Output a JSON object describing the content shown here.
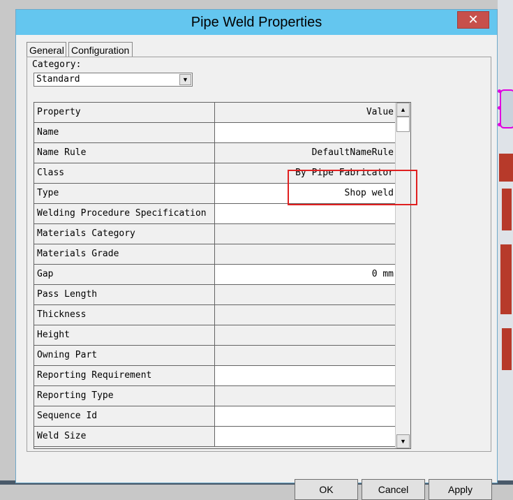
{
  "window": {
    "title": "Pipe Weld Properties",
    "close_glyph": "✕"
  },
  "tabs": [
    {
      "label": "General"
    },
    {
      "label": "Configuration"
    }
  ],
  "category": {
    "label": "Category:",
    "value": "Standard"
  },
  "grid": {
    "header": {
      "property": "Property",
      "value": "Value"
    },
    "rows": [
      {
        "property": "Name",
        "value": ""
      },
      {
        "property": "Name Rule",
        "value": "DefaultNameRule"
      },
      {
        "property": "Class",
        "value": "By Pipe Fabricator"
      },
      {
        "property": "Type",
        "value": "Shop weld"
      },
      {
        "property": "Welding Procedure Specification",
        "value": ""
      },
      {
        "property": "Materials Category",
        "value": ""
      },
      {
        "property": "Materials Grade",
        "value": ""
      },
      {
        "property": "Gap",
        "value": "0 mm"
      },
      {
        "property": "Pass Length",
        "value": ""
      },
      {
        "property": "Thickness",
        "value": ""
      },
      {
        "property": "Height",
        "value": ""
      },
      {
        "property": "Owning Part",
        "value": ""
      },
      {
        "property": "Reporting Requirement",
        "value": ""
      },
      {
        "property": "Reporting Type",
        "value": ""
      },
      {
        "property": "Sequence Id",
        "value": ""
      },
      {
        "property": "Weld Size",
        "value": ""
      }
    ]
  },
  "buttons": {
    "ok": "OK",
    "cancel": "Cancel",
    "apply": "Apply"
  },
  "colors": {
    "titlebar": "#64c6ef",
    "close": "#c7504b",
    "highlight": "#e02020"
  }
}
